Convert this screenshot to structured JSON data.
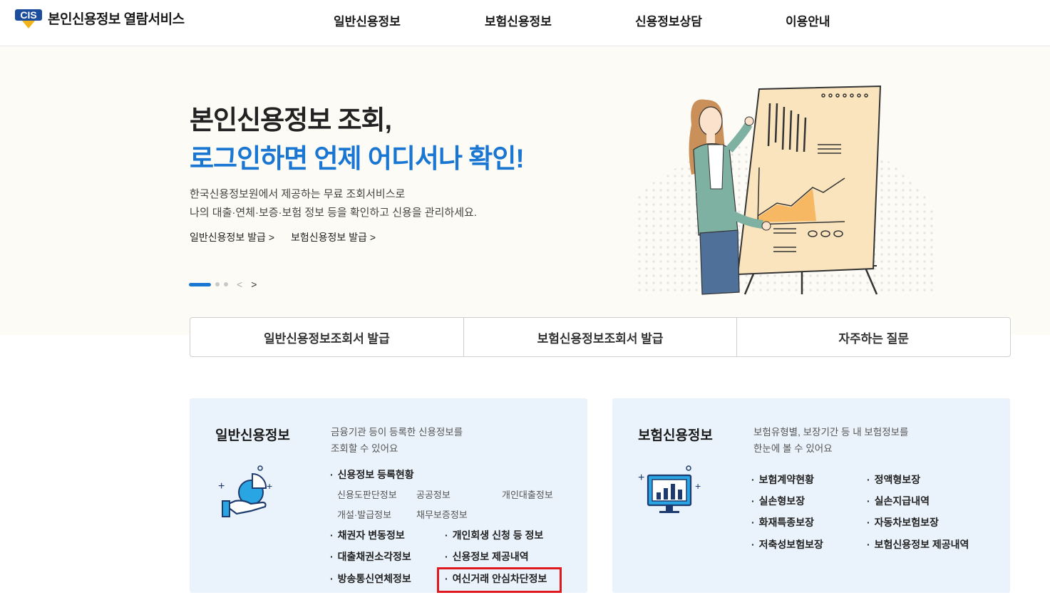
{
  "header": {
    "logo_mark": "CIS",
    "logo_text": "본인신용정보 열람서비스",
    "nav": [
      "일반신용정보",
      "보험신용정보",
      "신용정보상담",
      "이용안내"
    ]
  },
  "hero": {
    "title_line1": "본인신용정보 조회,",
    "title_line2": "로그인하면 언제 어디서나 확인!",
    "desc_line1": "한국신용정보원에서 제공하는 무료 조회서비스로",
    "desc_line2": "나의 대출·연체·보증·보험 정보 등을 확인하고 신용을 관리하세요.",
    "link1": "일반신용정보 발급 >",
    "link2": "보험신용정보 발급 >",
    "prev_arrow": "<",
    "next_arrow": ">"
  },
  "quick_menu": [
    "일반신용정보조회서 발급",
    "보험신용정보조회서 발급",
    "자주하는 질문"
  ],
  "general_card": {
    "title": "일반신용정보",
    "desc_line1": "금융기관 등이 등록한 신용정보를",
    "desc_line2": "조회할 수 있어요",
    "item_registration": "신용정보 등록현황",
    "sub_items": [
      "신용도판단정보",
      "공공정보",
      "개인대출정보",
      "개설·발급정보",
      "채무보증정보"
    ],
    "item_creditor_change": "채권자 변동정보",
    "item_rehab": "개인회생 신청 등 정보",
    "item_sold_loans": "대출채권소각정보",
    "item_provision": "신용정보 제공내역",
    "item_broadcast": "방송통신연체정보",
    "item_safety_block": "여신거래 안심차단정보"
  },
  "insurance_card": {
    "title": "보험신용정보",
    "desc_line1": "보험유형별, 보장기간 등 내 보험정보를",
    "desc_line2": "한눈에 볼 수 있어요",
    "items": [
      "보험계약현황",
      "정액형보장",
      "실손형보장",
      "실손지급내역",
      "화재특종보장",
      "자동차보험보장",
      "저축성보험보장",
      "보험신용정보 제공내역"
    ]
  },
  "colors": {
    "accent": "#1976d2",
    "card_bg": "#eaf3fb",
    "hero_bg": "#fdfbf5",
    "highlight": "#e0191e"
  },
  "icons": [
    "cis-logo-icon",
    "hand-chart-icon",
    "monitor-chart-icon",
    "presenter-illustration"
  ]
}
